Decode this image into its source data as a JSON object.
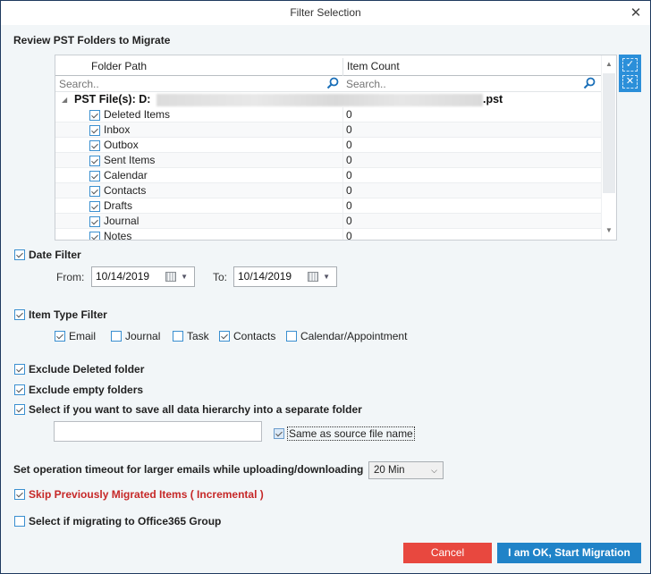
{
  "window": {
    "title": "Filter Selection",
    "close_icon": "close-icon"
  },
  "review": {
    "title": "Review PST Folders to Migrate",
    "columns": [
      "Folder Path",
      "Item Count"
    ],
    "search_placeholder_path": "Search..",
    "search_placeholder_count": "Search..",
    "root_label": "PST File(s): D:",
    "root_suffix": ".pst",
    "root_path_redacted": true,
    "folders": [
      {
        "name": "Deleted Items",
        "count": "0",
        "checked": true
      },
      {
        "name": "Inbox",
        "count": "0",
        "checked": true
      },
      {
        "name": "Outbox",
        "count": "0",
        "checked": true
      },
      {
        "name": "Sent Items",
        "count": "0",
        "checked": true
      },
      {
        "name": "Calendar",
        "count": "0",
        "checked": true
      },
      {
        "name": "Contacts",
        "count": "0",
        "checked": true
      },
      {
        "name": "Drafts",
        "count": "0",
        "checked": true
      },
      {
        "name": "Journal",
        "count": "0",
        "checked": true
      },
      {
        "name": "Notes",
        "count": "0",
        "checked": true
      }
    ],
    "side_tools": [
      {
        "icon": "select-all-icon",
        "glyph": "✓"
      },
      {
        "icon": "deselect-all-icon",
        "glyph": "✕"
      }
    ]
  },
  "date_filter": {
    "label": "Date Filter",
    "checked": true,
    "from_label": "From:",
    "from_value": "10/14/2019",
    "to_label": "To:",
    "to_value": "10/14/2019"
  },
  "item_type_filter": {
    "label": "Item Type Filter",
    "checked": true,
    "types": [
      {
        "label": "Email",
        "checked": true
      },
      {
        "label": "Journal",
        "checked": false
      },
      {
        "label": "Task",
        "checked": false
      },
      {
        "label": "Contacts",
        "checked": true
      },
      {
        "label": "Calendar/Appointment",
        "checked": false
      }
    ]
  },
  "options": {
    "exclude_deleted": {
      "label": "Exclude Deleted folder",
      "checked": true
    },
    "exclude_empty": {
      "label": "Exclude empty folders",
      "checked": true
    },
    "save_hierarchy": {
      "label": "Select if you want to save all data hierarchy into a separate folder",
      "checked": true
    },
    "folder_name_value": "",
    "same_as_source": {
      "label": "Same as source file name",
      "checked": true
    }
  },
  "timeout": {
    "label": "Set operation timeout for larger emails while uploading/downloading",
    "value": "20 Min"
  },
  "skip_migrated": {
    "label": "Skip Previously Migrated Items ( Incremental )",
    "checked": true,
    "color": "#c62828"
  },
  "office365_group": {
    "label": "Select if migrating to Office365 Group",
    "checked": false
  },
  "buttons": {
    "cancel": "Cancel",
    "start": "I am OK, Start Migration",
    "cancel_color": "#e8483f",
    "start_color": "#2083c8"
  }
}
